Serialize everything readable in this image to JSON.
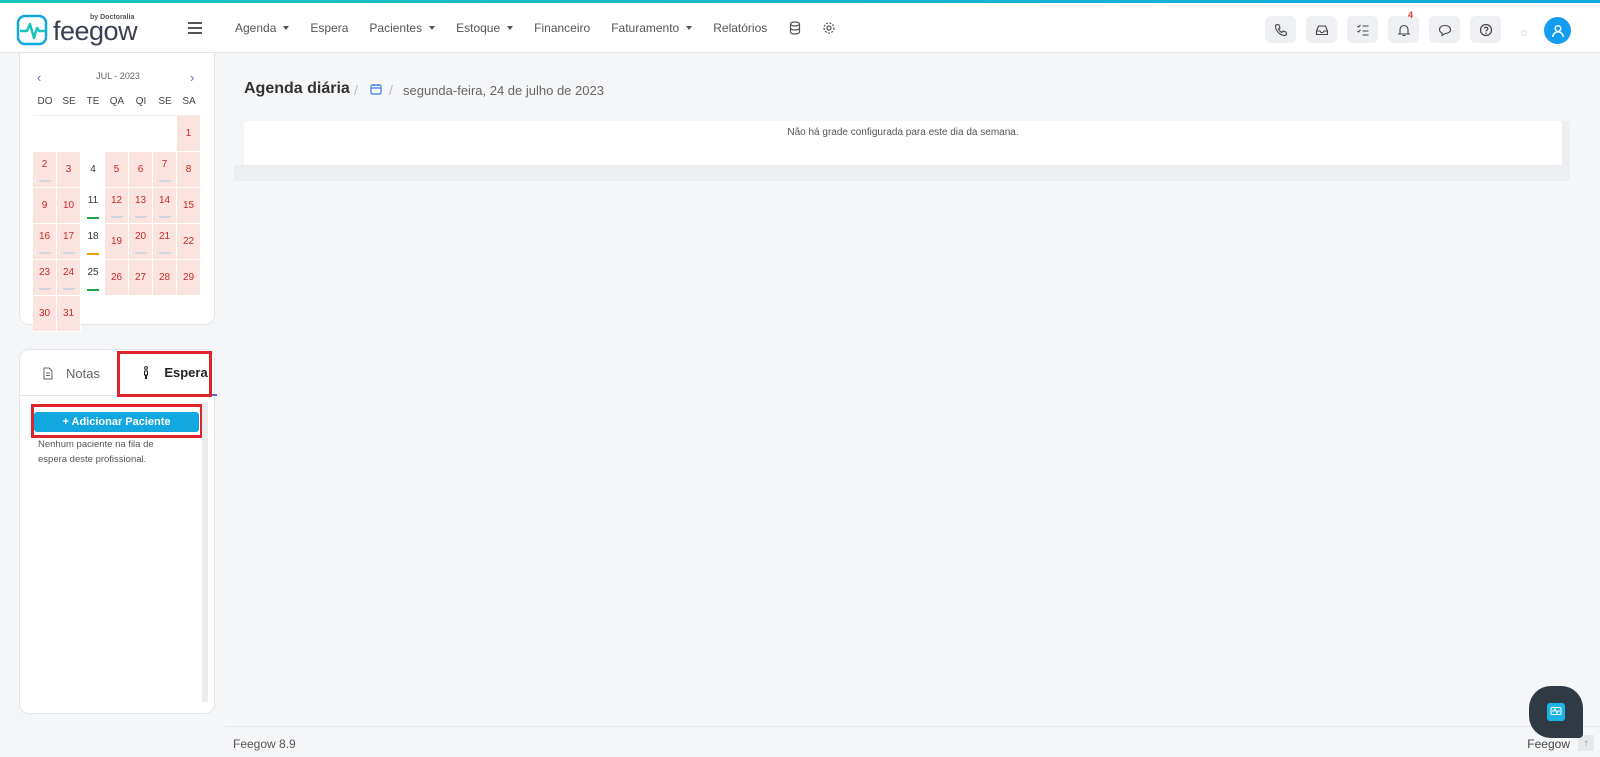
{
  "brand": {
    "name": "feegow",
    "by": "by Doctoralia"
  },
  "nav": {
    "items": [
      {
        "label": "Agenda",
        "dropdown": true
      },
      {
        "label": "Espera",
        "dropdown": false
      },
      {
        "label": "Pacientes",
        "dropdown": true
      },
      {
        "label": "Estoque",
        "dropdown": true
      },
      {
        "label": "Financeiro",
        "dropdown": false
      },
      {
        "label": "Faturamento",
        "dropdown": true
      },
      {
        "label": "Relatórios",
        "dropdown": false
      }
    ],
    "notification_count": "4"
  },
  "calendar": {
    "title": "JUL - 2023",
    "weekdays": [
      "DO",
      "SE",
      "TE",
      "QA",
      "QI",
      "SE",
      "SA"
    ],
    "weeks": [
      [
        "",
        "",
        "",
        "",
        "",
        "",
        "1"
      ],
      [
        "2",
        "3",
        "4",
        "5",
        "6",
        "7",
        "8"
      ],
      [
        "9",
        "10",
        "11",
        "12",
        "13",
        "14",
        "15"
      ],
      [
        "16",
        "17",
        "18",
        "19",
        "20",
        "21",
        "22"
      ],
      [
        "23",
        "24",
        "25",
        "26",
        "27",
        "28",
        "29"
      ],
      [
        "30",
        "31",
        "",
        "",
        "",
        "",
        ""
      ]
    ]
  },
  "waitlist": {
    "tab_notes": "Notas",
    "tab_wait": "Espera",
    "add_button": "+ Adicionar Paciente",
    "empty_message": "Nenhum paciente na fila de espera deste profissional."
  },
  "main": {
    "title": "Agenda diária",
    "date": "segunda-feira, 24 de julho de 2023",
    "no_grid_message": "Não há grade configurada para este dia da semana."
  },
  "footer": {
    "version": "Feegow 8.9",
    "brand": "Feegow"
  },
  "colors": {
    "accent": "#13a7e0",
    "highlight": "#e0242c",
    "off_day": "#fbe3df"
  }
}
